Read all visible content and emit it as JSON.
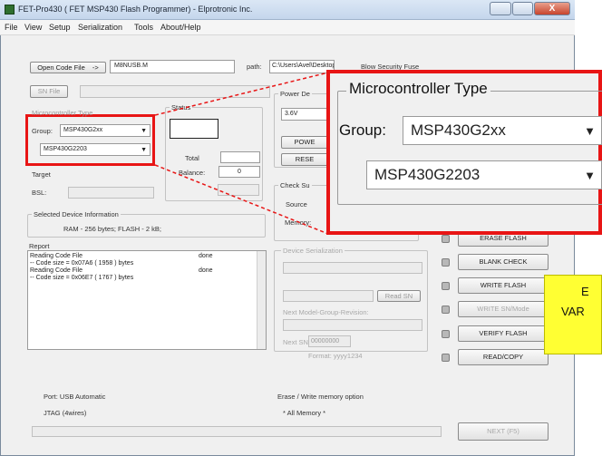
{
  "window": {
    "title": "FET-Pro430  ( FET MSP430 Flash Programmer)  -  Elprotronic Inc."
  },
  "menu": [
    "File",
    "View",
    "Setup",
    "Serialization",
    "Tools",
    "About/Help"
  ],
  "toolbar": {
    "open_code_file": "Open Code File",
    "open_arrow": "->",
    "code_name": "M8NUSB.M",
    "path_label": "path:",
    "path_value": "C:\\Users\\Avel\\Desktop\\ENTREGABLE",
    "blow_fuse": "Blow Security Fuse"
  },
  "sn_file": "SN File",
  "micro_small": {
    "title": "Microcontroller Type",
    "group_label": "Group:",
    "group_value": "MSP430G2xx",
    "device_value": "MSP430G2203"
  },
  "target_label": "Target",
  "bsl_label": "BSL:",
  "status": {
    "title": "Status",
    "total_label": "Total",
    "balance_label": "Balance:",
    "balance_value": "0"
  },
  "power": {
    "title": "Power De",
    "voltage": "3.6V",
    "power_btn": "POWE",
    "reset_btn": "RESE"
  },
  "check_sum": {
    "title": "Check Su",
    "source_label": "Source",
    "memory_label": "Memory:"
  },
  "selected_info": {
    "title": "Selected Device Information",
    "text": "RAM - 256 bytes;   FLASH - 2 kB;"
  },
  "report": {
    "title": "Report",
    "lines": [
      {
        "text": "Reading Code File",
        "status": "done"
      },
      {
        "text": "-- Code size = 0x07A6 ( 1958 ) bytes",
        "status": ""
      },
      {
        "text": "Reading Code File",
        "status": "done"
      },
      {
        "text": "-- Code size = 0x06E7 ( 1767 ) bytes",
        "status": ""
      }
    ]
  },
  "serialization": {
    "title": "Device Serialization",
    "read_sn": "Read SN",
    "next_model": "Next Model-Group-Revision:",
    "next_sn_label": "Next SN",
    "next_sn_value": "00000000",
    "format_label": "Format: yyyy1234"
  },
  "actions": [
    "ERASE FLASH",
    "BLANK CHECK",
    "WRITE FLASH",
    "WRITE SN/Mode",
    "VERIFY FLASH",
    "READ/COPY"
  ],
  "port": {
    "label": "Port: USB Automatic",
    "jtag": "JTAG (4wires)"
  },
  "erase_option": {
    "label": "Erase / Write memory option",
    "value": "* All Memory *"
  },
  "next_button": "NEXT  (F5)",
  "zoom": {
    "title": "Microcontroller Type",
    "group_label": "Group:",
    "group_value": "MSP430G2xx",
    "device_value": "MSP430G2203"
  },
  "callout": {
    "line1": "E",
    "line2": "VAR"
  },
  "colors": {
    "highlight_red": "#e81515",
    "callout_yellow": "#ffff33"
  }
}
